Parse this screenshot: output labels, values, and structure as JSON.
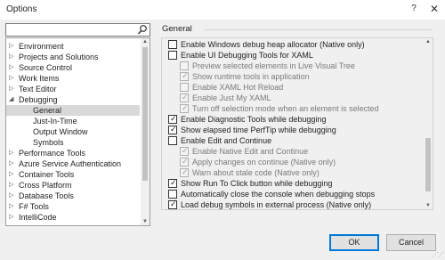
{
  "window": {
    "title": "Options",
    "help_label": "?",
    "close_label": "✕"
  },
  "search": {
    "placeholder": "",
    "value": ""
  },
  "tree": {
    "items": [
      {
        "label": "Environment",
        "expander": "▷",
        "indent": 0,
        "selected": false
      },
      {
        "label": "Projects and Solutions",
        "expander": "▷",
        "indent": 0,
        "selected": false
      },
      {
        "label": "Source Control",
        "expander": "▷",
        "indent": 0,
        "selected": false
      },
      {
        "label": "Work Items",
        "expander": "▷",
        "indent": 0,
        "selected": false
      },
      {
        "label": "Text Editor",
        "expander": "▷",
        "indent": 0,
        "selected": false
      },
      {
        "label": "Debugging",
        "expander": "◢",
        "indent": 0,
        "selected": false
      },
      {
        "label": "General",
        "expander": "",
        "indent": 1,
        "selected": true
      },
      {
        "label": "Just-In-Time",
        "expander": "",
        "indent": 1,
        "selected": false
      },
      {
        "label": "Output Window",
        "expander": "",
        "indent": 1,
        "selected": false
      },
      {
        "label": "Symbols",
        "expander": "",
        "indent": 1,
        "selected": false
      },
      {
        "label": "Performance Tools",
        "expander": "▷",
        "indent": 0,
        "selected": false
      },
      {
        "label": "Azure Service Authentication",
        "expander": "▷",
        "indent": 0,
        "selected": false
      },
      {
        "label": "Container Tools",
        "expander": "▷",
        "indent": 0,
        "selected": false
      },
      {
        "label": "Cross Platform",
        "expander": "▷",
        "indent": 0,
        "selected": false
      },
      {
        "label": "Database Tools",
        "expander": "▷",
        "indent": 0,
        "selected": false
      },
      {
        "label": "F# Tools",
        "expander": "▷",
        "indent": 0,
        "selected": false
      },
      {
        "label": "IntelliCode",
        "expander": "▷",
        "indent": 0,
        "selected": false
      }
    ]
  },
  "section": {
    "title": "General"
  },
  "options": [
    {
      "label": "Enable Windows debug heap allocator (Native only)",
      "checked": false,
      "disabled": false,
      "indent": 0
    },
    {
      "label": "Enable UI Debugging Tools for XAML",
      "checked": false,
      "disabled": false,
      "indent": 0
    },
    {
      "label": "Preview selected elements in Live Visual Tree",
      "checked": false,
      "disabled": true,
      "indent": 1
    },
    {
      "label": "Show runtime tools in application",
      "checked": true,
      "disabled": true,
      "indent": 1
    },
    {
      "label": "Enable XAML Hot Reload",
      "checked": false,
      "disabled": true,
      "indent": 1
    },
    {
      "label": "Enable Just My XAML",
      "checked": true,
      "disabled": true,
      "indent": 1
    },
    {
      "label": "Turn off selection mode when an element is selected",
      "checked": true,
      "disabled": true,
      "indent": 1
    },
    {
      "label": "Enable Diagnostic Tools while debugging",
      "checked": true,
      "disabled": false,
      "indent": 0
    },
    {
      "label": "Show elapsed time PerfTip while debugging",
      "checked": true,
      "disabled": false,
      "indent": 0
    },
    {
      "label": "Enable Edit and Continue",
      "checked": false,
      "disabled": false,
      "indent": 0
    },
    {
      "label": "Enable Native Edit and Continue",
      "checked": true,
      "disabled": true,
      "indent": 1
    },
    {
      "label": "Apply changes on continue (Native only)",
      "checked": true,
      "disabled": true,
      "indent": 1
    },
    {
      "label": "Warn about stale code (Native only)",
      "checked": true,
      "disabled": true,
      "indent": 1
    },
    {
      "label": "Show Run To Click button while debugging",
      "checked": true,
      "disabled": false,
      "indent": 0
    },
    {
      "label": "Automatically close the console when debugging stops",
      "checked": false,
      "disabled": false,
      "indent": 0
    },
    {
      "label": "Load debug symbols in external process (Native only)",
      "checked": true,
      "disabled": false,
      "indent": 0
    }
  ],
  "buttons": {
    "ok": "OK",
    "cancel": "Cancel"
  }
}
